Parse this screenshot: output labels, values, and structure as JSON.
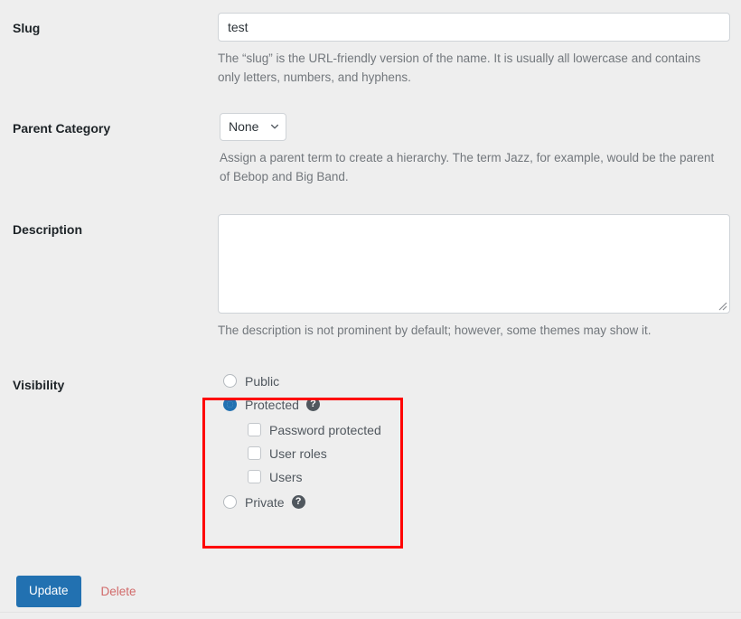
{
  "form": {
    "rows": [
      {
        "label": "Slug",
        "field_type": "text",
        "value": "test",
        "help": "The “slug” is the URL-friendly version of the name. It is usually all lowercase and contains only letters, numbers, and hyphens."
      },
      {
        "label": "Parent Category",
        "field_type": "select",
        "value": "None",
        "help": "Assign a parent term to create a hierarchy. The term Jazz, for example, would be the parent of Bebop and Big Band."
      },
      {
        "label": "Description",
        "field_type": "textarea",
        "value": "",
        "help": "The description is not prominent by default; however, some themes may show it."
      },
      {
        "label": "Visibility",
        "field_type": "radio-group",
        "value": "Protected",
        "help": ""
      }
    ]
  },
  "visibility": {
    "label": "Visibility",
    "options": [
      {
        "label": "Public",
        "checked": false,
        "has_help": false
      },
      {
        "label": "Protected",
        "checked": true,
        "has_help": true
      },
      {
        "label": "Private",
        "checked": false,
        "has_help": true
      }
    ],
    "sub_options": [
      {
        "label": "Password protected",
        "checked": false
      },
      {
        "label": "User roles",
        "checked": false
      },
      {
        "label": "Users",
        "checked": false
      }
    ],
    "help_glyph": "?"
  },
  "actions": {
    "update_label": "Update",
    "delete_label": "Delete"
  },
  "colors": {
    "accent_blue": "#2271b1",
    "delete_red": "#d16a6a",
    "highlight_red": "#ff0000",
    "page_background": "#eeeeee"
  }
}
